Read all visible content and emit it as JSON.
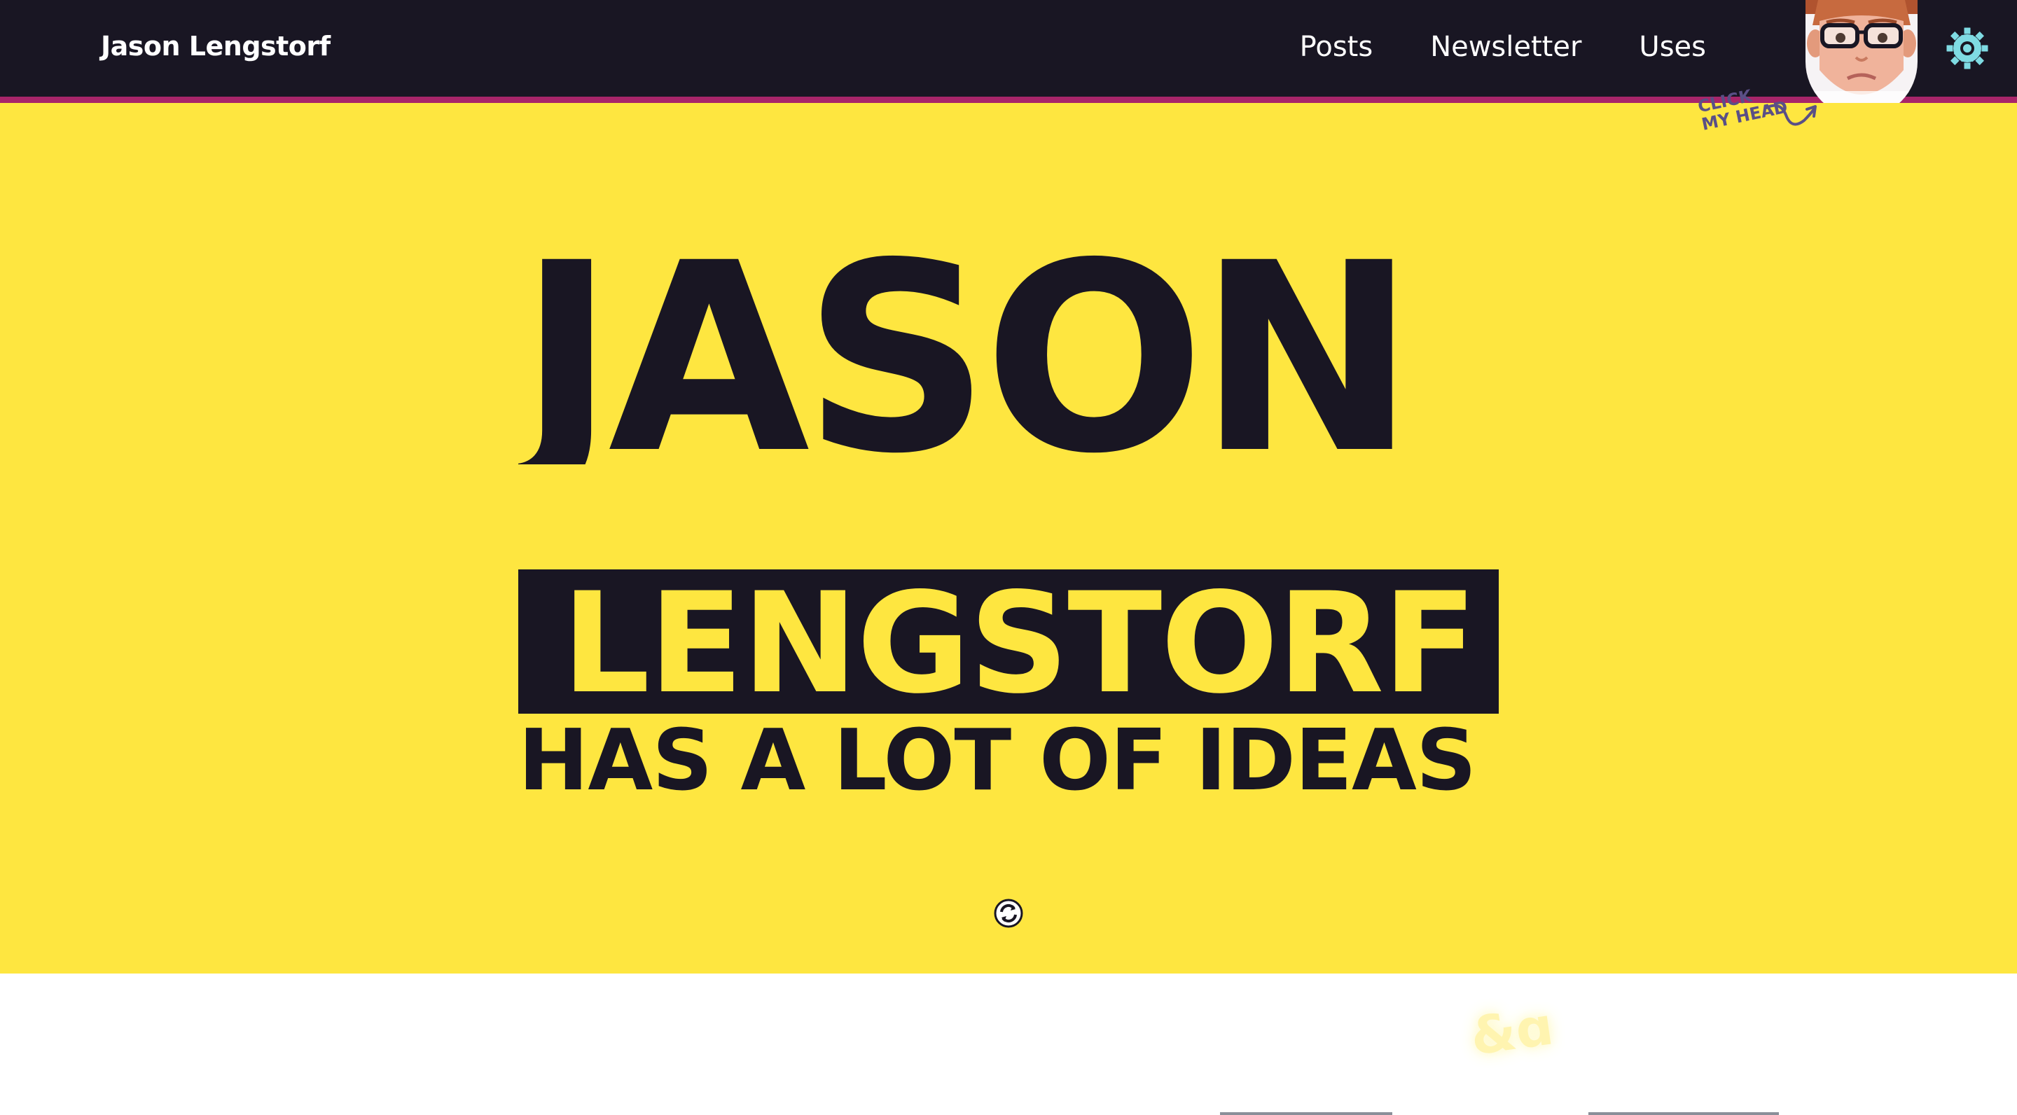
{
  "header": {
    "site_title": "Jason Lengstorf",
    "nav": [
      {
        "label": "Posts"
      },
      {
        "label": "Newsletter"
      },
      {
        "label": "Uses"
      }
    ],
    "avatar_icon": "avatar-head-upside-down",
    "settings_icon": "gear-icon",
    "click_hint": "CLICK\nMY HEAD"
  },
  "hero": {
    "line1": "JASON",
    "line2": "LENGSTORF",
    "line3": "HAS A LOT OF IDEAS",
    "refresh_icon": "refresh-icon",
    "sparkle_glyph": "&ɑ"
  },
  "colors": {
    "header_bg": "#191623",
    "header_border": "#a8256a",
    "hero_bg": "#fee640",
    "ink": "#191623",
    "gear": "#7fdbe3"
  }
}
